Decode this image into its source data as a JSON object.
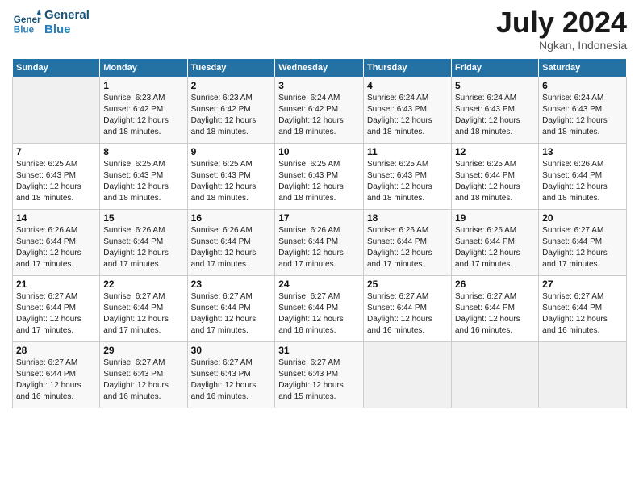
{
  "header": {
    "logo_line1": "General",
    "logo_line2": "Blue",
    "month": "July 2024",
    "location": "Ngkan, Indonesia"
  },
  "days_of_week": [
    "Sunday",
    "Monday",
    "Tuesday",
    "Wednesday",
    "Thursday",
    "Friday",
    "Saturday"
  ],
  "weeks": [
    [
      {
        "day": "",
        "info": ""
      },
      {
        "day": "1",
        "info": "Sunrise: 6:23 AM\nSunset: 6:42 PM\nDaylight: 12 hours\nand 18 minutes."
      },
      {
        "day": "2",
        "info": "Sunrise: 6:23 AM\nSunset: 6:42 PM\nDaylight: 12 hours\nand 18 minutes."
      },
      {
        "day": "3",
        "info": "Sunrise: 6:24 AM\nSunset: 6:42 PM\nDaylight: 12 hours\nand 18 minutes."
      },
      {
        "day": "4",
        "info": "Sunrise: 6:24 AM\nSunset: 6:43 PM\nDaylight: 12 hours\nand 18 minutes."
      },
      {
        "day": "5",
        "info": "Sunrise: 6:24 AM\nSunset: 6:43 PM\nDaylight: 12 hours\nand 18 minutes."
      },
      {
        "day": "6",
        "info": "Sunrise: 6:24 AM\nSunset: 6:43 PM\nDaylight: 12 hours\nand 18 minutes."
      }
    ],
    [
      {
        "day": "7",
        "info": "Sunrise: 6:25 AM\nSunset: 6:43 PM\nDaylight: 12 hours\nand 18 minutes."
      },
      {
        "day": "8",
        "info": "Sunrise: 6:25 AM\nSunset: 6:43 PM\nDaylight: 12 hours\nand 18 minutes."
      },
      {
        "day": "9",
        "info": "Sunrise: 6:25 AM\nSunset: 6:43 PM\nDaylight: 12 hours\nand 18 minutes."
      },
      {
        "day": "10",
        "info": "Sunrise: 6:25 AM\nSunset: 6:43 PM\nDaylight: 12 hours\nand 18 minutes."
      },
      {
        "day": "11",
        "info": "Sunrise: 6:25 AM\nSunset: 6:43 PM\nDaylight: 12 hours\nand 18 minutes."
      },
      {
        "day": "12",
        "info": "Sunrise: 6:25 AM\nSunset: 6:44 PM\nDaylight: 12 hours\nand 18 minutes."
      },
      {
        "day": "13",
        "info": "Sunrise: 6:26 AM\nSunset: 6:44 PM\nDaylight: 12 hours\nand 18 minutes."
      }
    ],
    [
      {
        "day": "14",
        "info": "Sunrise: 6:26 AM\nSunset: 6:44 PM\nDaylight: 12 hours\nand 17 minutes."
      },
      {
        "day": "15",
        "info": "Sunrise: 6:26 AM\nSunset: 6:44 PM\nDaylight: 12 hours\nand 17 minutes."
      },
      {
        "day": "16",
        "info": "Sunrise: 6:26 AM\nSunset: 6:44 PM\nDaylight: 12 hours\nand 17 minutes."
      },
      {
        "day": "17",
        "info": "Sunrise: 6:26 AM\nSunset: 6:44 PM\nDaylight: 12 hours\nand 17 minutes."
      },
      {
        "day": "18",
        "info": "Sunrise: 6:26 AM\nSunset: 6:44 PM\nDaylight: 12 hours\nand 17 minutes."
      },
      {
        "day": "19",
        "info": "Sunrise: 6:26 AM\nSunset: 6:44 PM\nDaylight: 12 hours\nand 17 minutes."
      },
      {
        "day": "20",
        "info": "Sunrise: 6:27 AM\nSunset: 6:44 PM\nDaylight: 12 hours\nand 17 minutes."
      }
    ],
    [
      {
        "day": "21",
        "info": "Sunrise: 6:27 AM\nSunset: 6:44 PM\nDaylight: 12 hours\nand 17 minutes."
      },
      {
        "day": "22",
        "info": "Sunrise: 6:27 AM\nSunset: 6:44 PM\nDaylight: 12 hours\nand 17 minutes."
      },
      {
        "day": "23",
        "info": "Sunrise: 6:27 AM\nSunset: 6:44 PM\nDaylight: 12 hours\nand 17 minutes."
      },
      {
        "day": "24",
        "info": "Sunrise: 6:27 AM\nSunset: 6:44 PM\nDaylight: 12 hours\nand 16 minutes."
      },
      {
        "day": "25",
        "info": "Sunrise: 6:27 AM\nSunset: 6:44 PM\nDaylight: 12 hours\nand 16 minutes."
      },
      {
        "day": "26",
        "info": "Sunrise: 6:27 AM\nSunset: 6:44 PM\nDaylight: 12 hours\nand 16 minutes."
      },
      {
        "day": "27",
        "info": "Sunrise: 6:27 AM\nSunset: 6:44 PM\nDaylight: 12 hours\nand 16 minutes."
      }
    ],
    [
      {
        "day": "28",
        "info": "Sunrise: 6:27 AM\nSunset: 6:44 PM\nDaylight: 12 hours\nand 16 minutes."
      },
      {
        "day": "29",
        "info": "Sunrise: 6:27 AM\nSunset: 6:43 PM\nDaylight: 12 hours\nand 16 minutes."
      },
      {
        "day": "30",
        "info": "Sunrise: 6:27 AM\nSunset: 6:43 PM\nDaylight: 12 hours\nand 16 minutes."
      },
      {
        "day": "31",
        "info": "Sunrise: 6:27 AM\nSunset: 6:43 PM\nDaylight: 12 hours\nand 15 minutes."
      },
      {
        "day": "",
        "info": ""
      },
      {
        "day": "",
        "info": ""
      },
      {
        "day": "",
        "info": ""
      }
    ]
  ]
}
